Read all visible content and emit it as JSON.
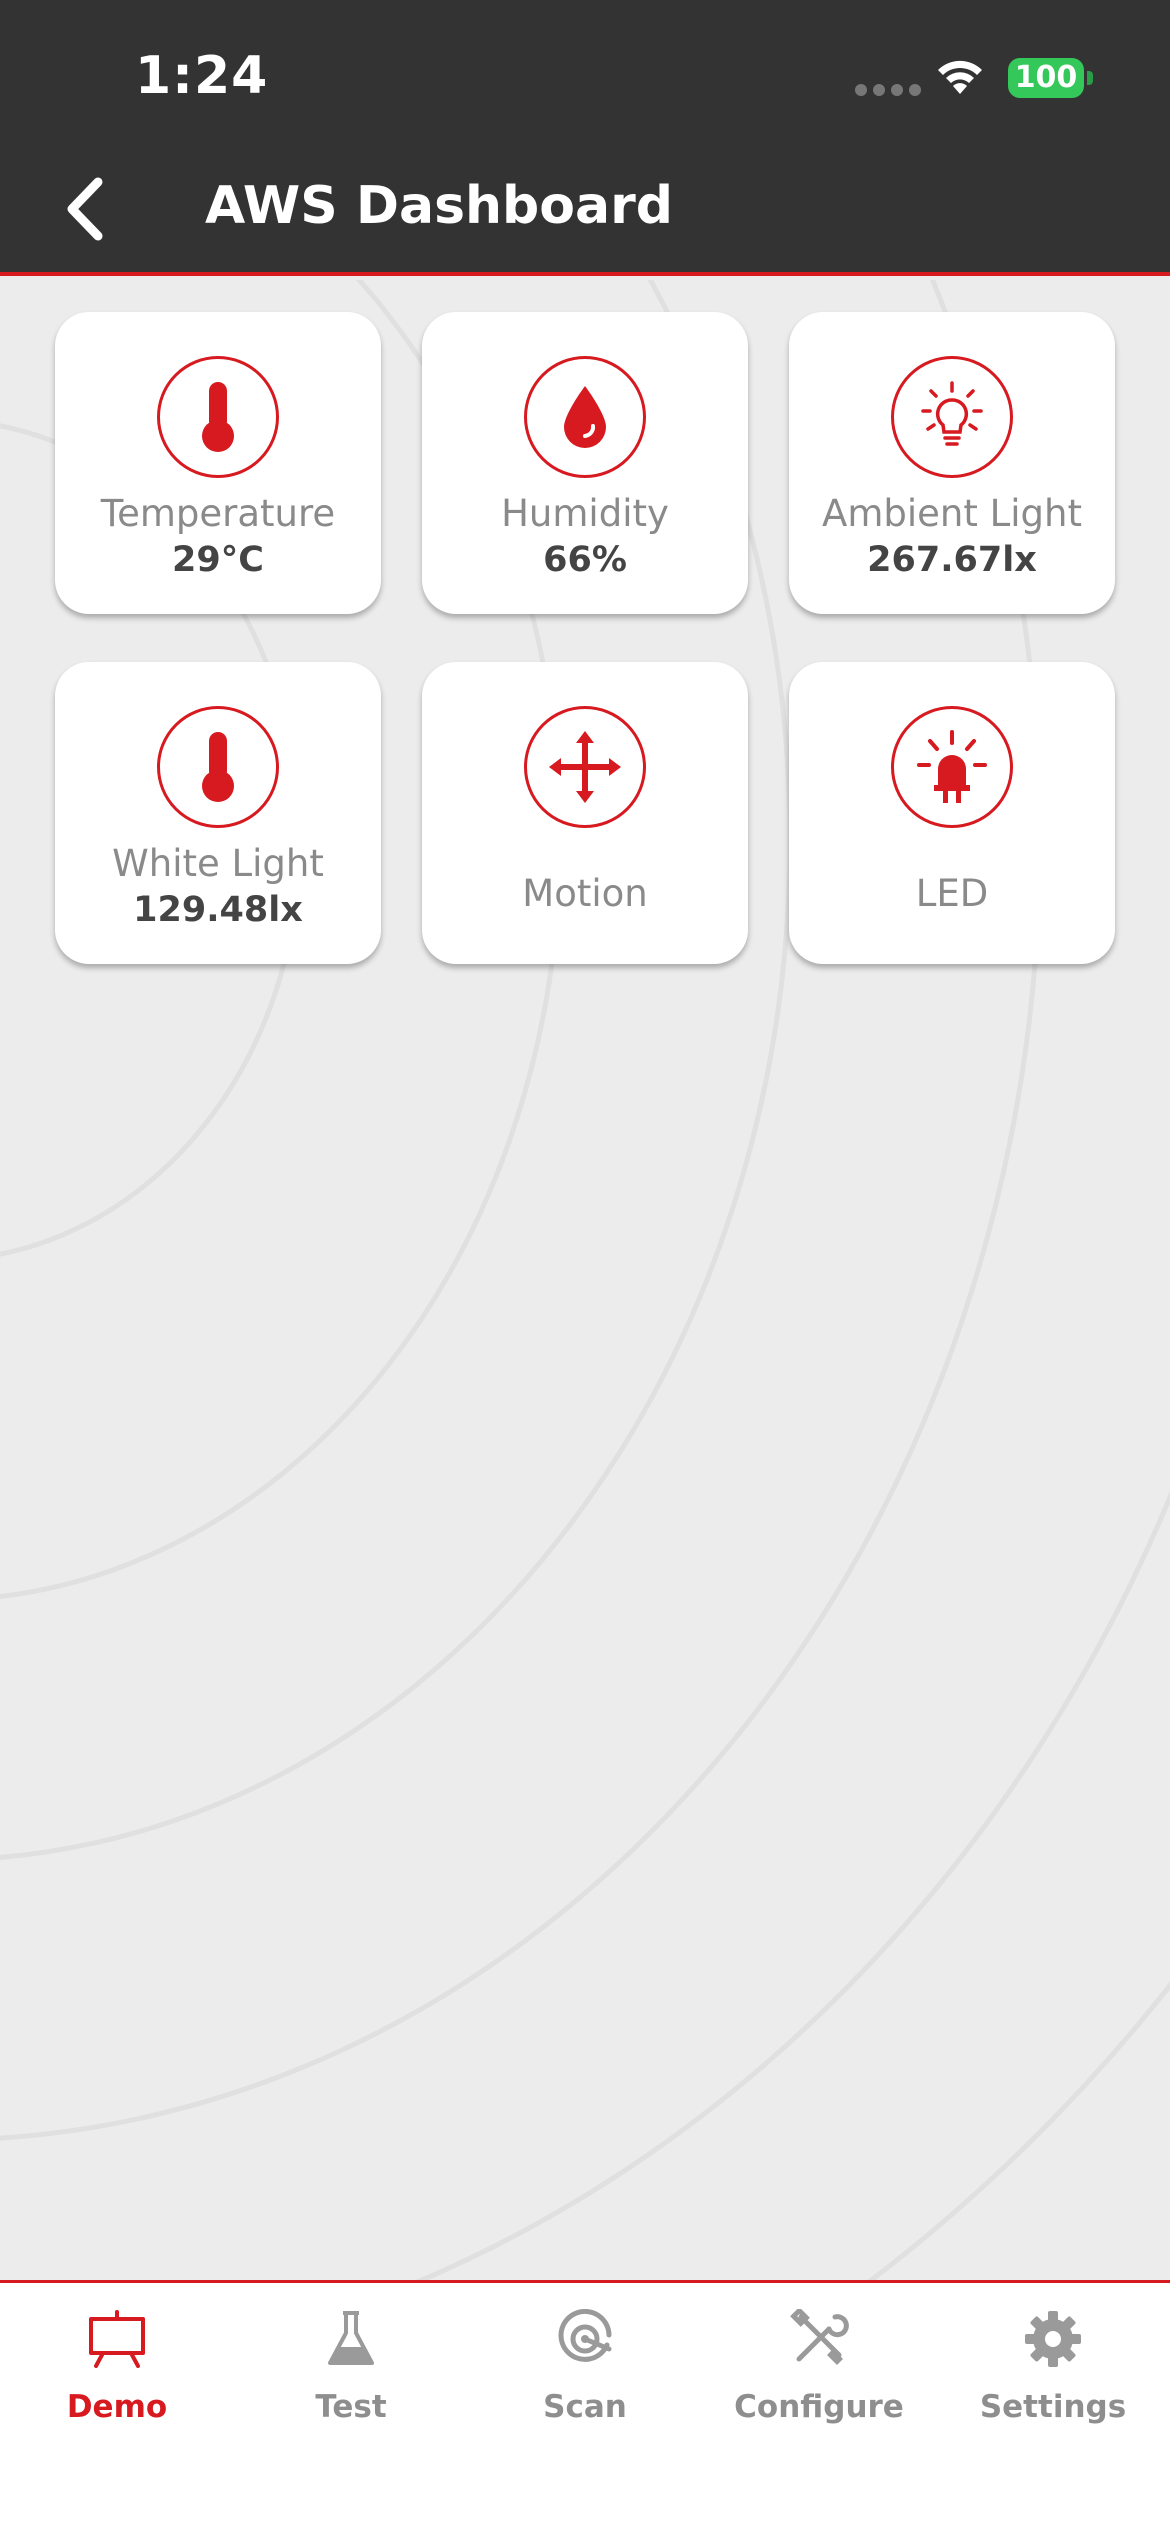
{
  "status_bar": {
    "time": "1:24",
    "battery": "100"
  },
  "header": {
    "title": "AWS Dashboard"
  },
  "tiles": [
    {
      "label": "Temperature",
      "value": "29°C",
      "icon": "thermometer-icon"
    },
    {
      "label": "Humidity",
      "value": "66%",
      "icon": "droplet-icon"
    },
    {
      "label": "Ambient Light",
      "value": "267.67lx",
      "icon": "lightbulb-icon"
    },
    {
      "label": "White Light",
      "value": "129.48lx",
      "icon": "thermometer-icon"
    },
    {
      "label": "Motion",
      "value": "",
      "icon": "move-arrows-icon"
    },
    {
      "label": "LED",
      "value": "",
      "icon": "led-icon"
    }
  ],
  "tabbar": {
    "items": [
      {
        "label": "Demo",
        "icon": "presentation-board-icon",
        "active": true
      },
      {
        "label": "Test",
        "icon": "flask-icon",
        "active": false
      },
      {
        "label": "Scan",
        "icon": "scan-target-icon",
        "active": false
      },
      {
        "label": "Configure",
        "icon": "tools-icon",
        "active": false
      },
      {
        "label": "Settings",
        "icon": "gear-icon",
        "active": false
      }
    ]
  },
  "colors": {
    "accent": "#d71920",
    "header_bg": "#333333",
    "page_bg": "#ececec",
    "battery": "#34c759"
  }
}
